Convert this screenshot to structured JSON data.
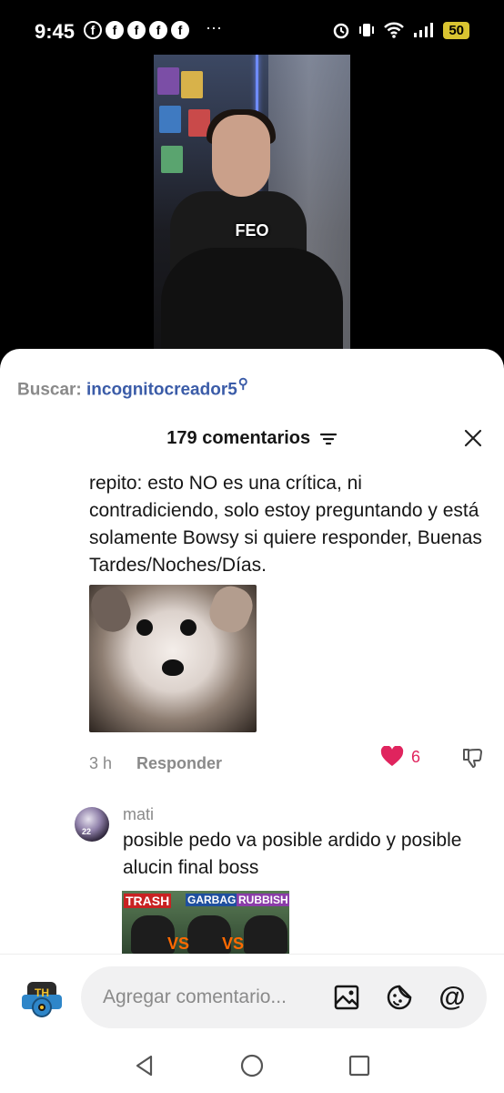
{
  "status_bar": {
    "time": "9:45",
    "notification_icons": [
      "facebook-icon",
      "facebook-icon",
      "facebook-icon",
      "facebook-icon",
      "facebook-icon"
    ],
    "more": "···",
    "battery": "50"
  },
  "video": {
    "caption": "FEO"
  },
  "search": {
    "label": "Buscar:",
    "query": "incognitocreador5"
  },
  "comments_header": {
    "count_label": "179 comentarios"
  },
  "comments": [
    {
      "text": "repito: esto NO es una crítica, ni contradiciendo, solo estoy preguntando y está solamente Bowsy si quiere responder, Buenas Tardes/Noches/Días.",
      "time": "3 h",
      "reply_label": "Responder",
      "likes": "6",
      "liked": true
    },
    {
      "username": "mati",
      "avatar_text": "22",
      "text": "posible pedo va posible ardido y posible alucin final boss",
      "image_labels": [
        "TRASH",
        "GARBAGE",
        "RUBBISH"
      ],
      "image_vs": "VS"
    }
  ],
  "composer": {
    "avatar_text": "TH",
    "placeholder": "Agregar comentario..."
  },
  "colors": {
    "accent_like": "#e0245e",
    "search_query": "#3b5ca8"
  }
}
